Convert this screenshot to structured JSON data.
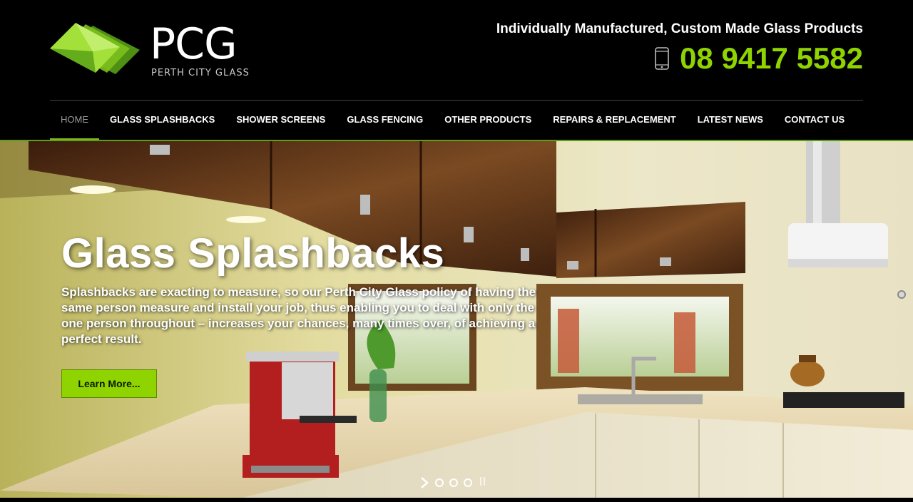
{
  "brand": {
    "name": "PCG",
    "subtitle": "PERTH CITY GLASS"
  },
  "header": {
    "tagline": "Individually Manufactured, Custom Made Glass Products",
    "phone": "08 9417 5582",
    "phone_icon": "mobile-phone-icon"
  },
  "nav": {
    "items": [
      {
        "label": "HOME",
        "active": true
      },
      {
        "label": "GLASS SPLASHBACKS"
      },
      {
        "label": "SHOWER SCREENS"
      },
      {
        "label": "GLASS FENCING"
      },
      {
        "label": "OTHER PRODUCTS"
      },
      {
        "label": "REPAIRS & REPLACEMENT"
      },
      {
        "label": "LATEST NEWS"
      },
      {
        "label": "CONTACT US"
      }
    ]
  },
  "hero": {
    "title": "Glass Splashbacks",
    "text": "Splashbacks are exacting to measure, so our Perth City Glass policy of having the same person measure and install your job, thus enabling you to deal with only the one person throughout – increases your chances, many times over, of achieving a perfect result.",
    "button": "Learn More...",
    "slides": 3,
    "image": "kitchen-with-glass-splashback"
  },
  "colors": {
    "accent": "#8fd400",
    "header_bg": "#000000",
    "nav_active_underline": "#7cc11c"
  }
}
